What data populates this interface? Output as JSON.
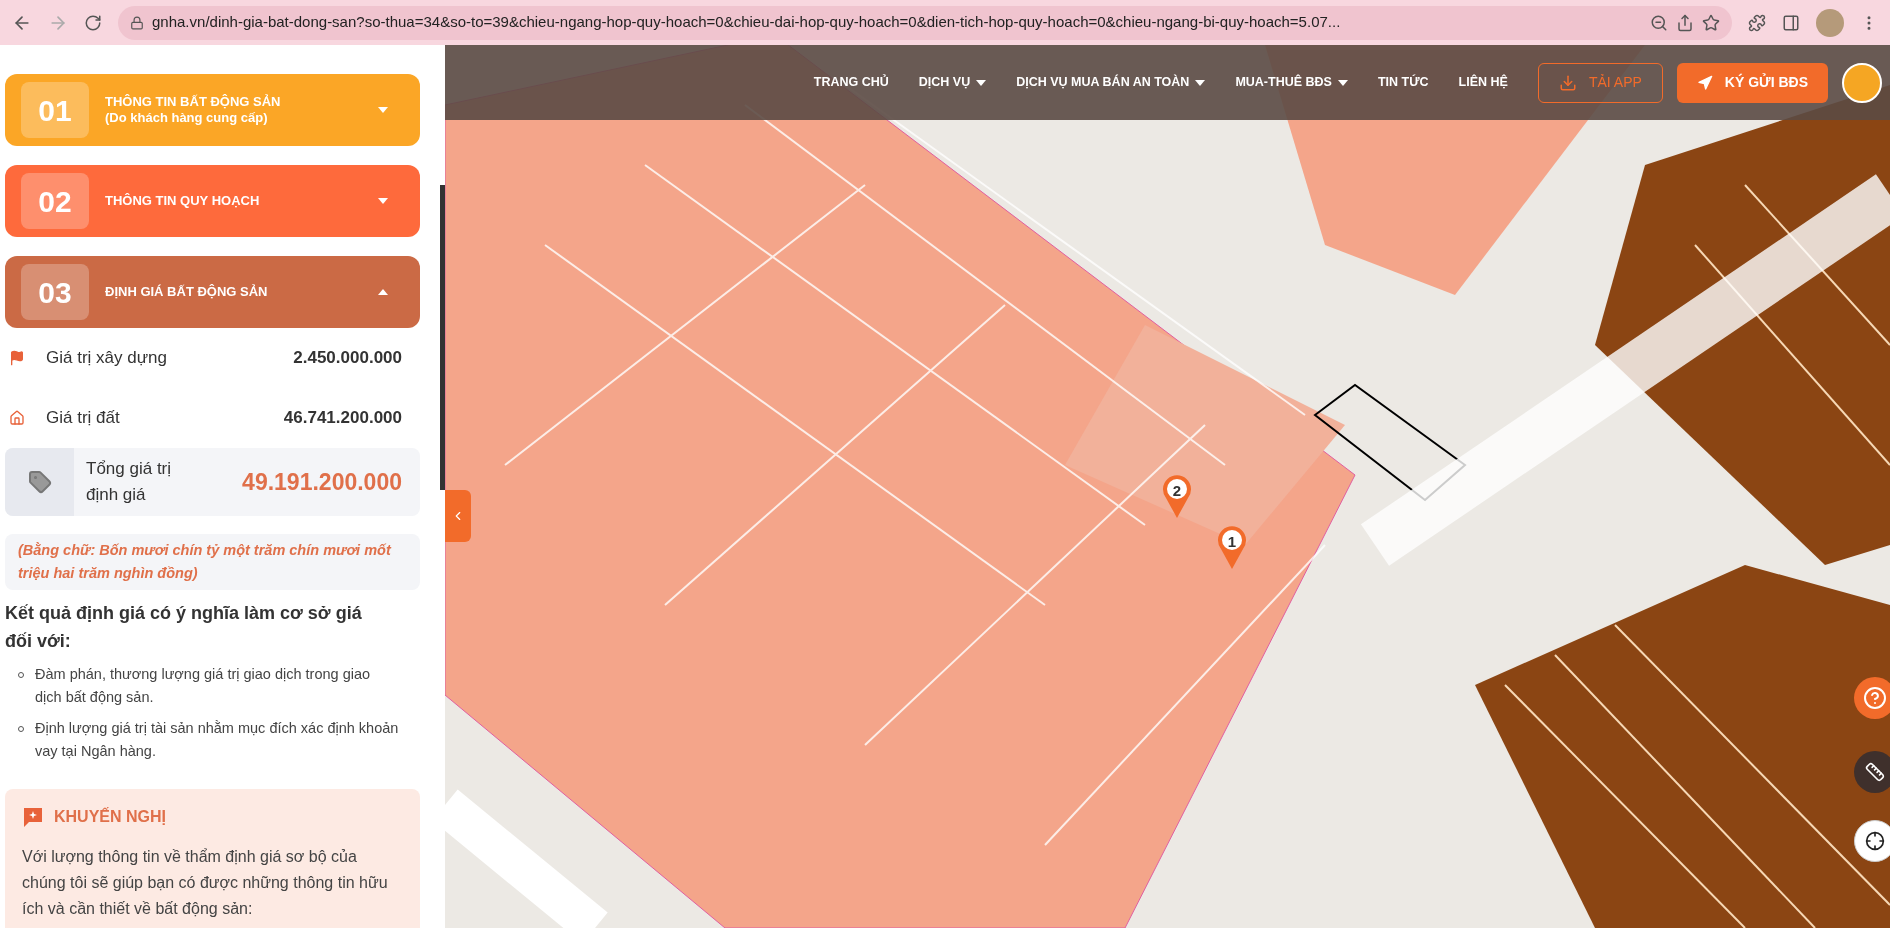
{
  "browser": {
    "url": "gnha.vn/dinh-gia-bat-dong-san?so-thua=34&so-to=39&chieu-ngang-hop-quy-hoach=0&chieu-dai-hop-quy-hoach=0&dien-tich-hop-quy-hoach=0&chieu-ngang-bi-quy-hoach=5.07..."
  },
  "sidebar": {
    "sections": [
      {
        "number": "01",
        "title": "THÔNG TIN BẤT ĐỘNG SẢN",
        "subtitle": "(Do khách hàng cung cấp)",
        "expanded": false,
        "color": "#fba626"
      },
      {
        "number": "02",
        "title": "THÔNG TIN QUY HOẠCH",
        "expanded": false,
        "color": "#fe6a3c"
      },
      {
        "number": "03",
        "title": "ĐỊNH GIÁ BẤT ĐỘNG SẢN",
        "expanded": true,
        "color": "#cb6a45"
      }
    ],
    "values": [
      {
        "kind": "flag",
        "label": "Giá trị xây dựng",
        "value": "2.450.000.000"
      },
      {
        "kind": "land",
        "label": "Giá trị đất",
        "value": "46.741.200.000"
      }
    ],
    "total": {
      "label": "Tổng giá trị định giá",
      "value": "49.191.200.000"
    },
    "in_words": "(Bằng chữ: Bốn mươi chín tỷ một trăm chín mươi mốt triệu hai trăm nghìn đồng)",
    "purpose": {
      "heading": "Kết quả định giá có ý nghĩa làm cơ sở giá đối với:",
      "items": [
        "Đàm phán, thương lượng giá trị giao dịch trong giao dịch bất động sản.",
        "Định lượng giá trị tài sản nhằm mục đích xác định khoản vay tại Ngân hàng."
      ]
    },
    "recommendation": {
      "title": "KHUYẾN NGHỊ",
      "text": "Với lượng thông tin về thẩm định giá sơ bộ của chúng tôi sẽ giúp bạn có được những thông tin hữu ích và cần thiết về bất động sản:"
    }
  },
  "nav": {
    "items": [
      {
        "label": "TRANG CHỦ",
        "dropdown": false
      },
      {
        "label": "DỊCH VỤ",
        "dropdown": true
      },
      {
        "label": "DỊCH VỤ MUA BÁN AN TOÀN",
        "dropdown": true
      },
      {
        "label": "MUA-THUÊ BĐS",
        "dropdown": true
      },
      {
        "label": "TIN TỨC",
        "dropdown": false
      },
      {
        "label": "LIÊN HỆ",
        "dropdown": false
      }
    ],
    "buttons": [
      {
        "kind": "outline",
        "label": "TẢI APP"
      },
      {
        "kind": "filled",
        "label": "KÝ GỬI BĐS"
      }
    ]
  },
  "map": {
    "pins": [
      {
        "label": "2"
      },
      {
        "label": "1"
      }
    ]
  }
}
